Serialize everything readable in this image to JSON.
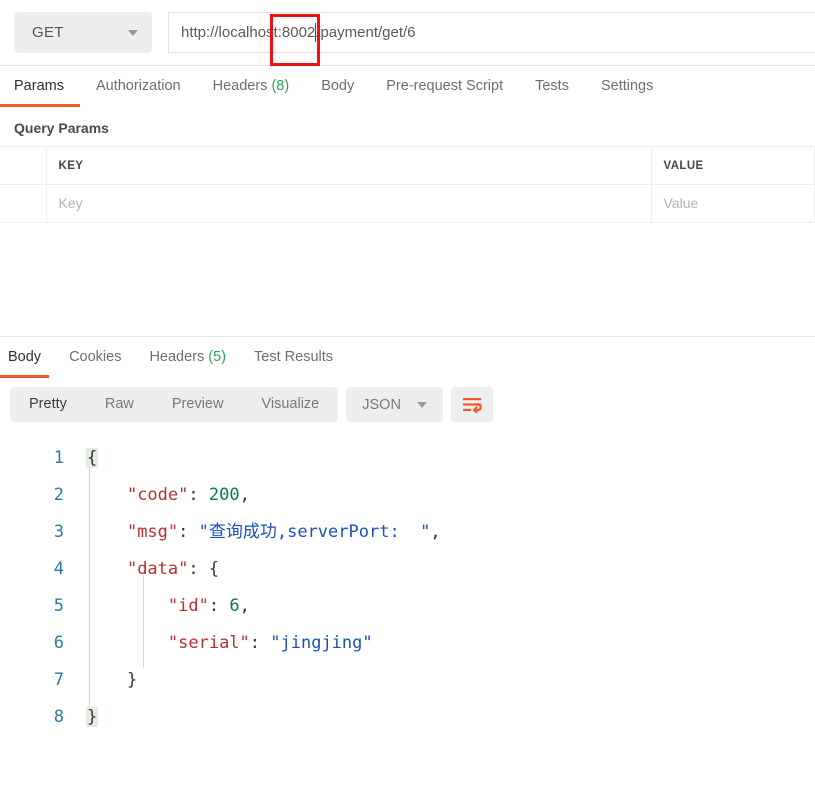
{
  "request": {
    "method": "GET",
    "url_prefix": "http://localhost",
    "url_port": ":8002",
    "url_suffix": "/payment/get/6",
    "url_full": "http://localhost:8002/payment/get/6",
    "annotation_color": "#ee1111",
    "tabs": [
      {
        "label": "Params",
        "active": true
      },
      {
        "label": "Authorization",
        "active": false
      },
      {
        "label": "Headers",
        "count": "(8)",
        "active": false
      },
      {
        "label": "Body",
        "active": false
      },
      {
        "label": "Pre-request Script",
        "active": false
      },
      {
        "label": "Tests",
        "active": false
      },
      {
        "label": "Settings",
        "active": false
      }
    ],
    "query_params_label": "Query Params",
    "table": {
      "headers": [
        "KEY",
        "VALUE"
      ],
      "placeholder_row": {
        "key": "Key",
        "value": "Value"
      }
    }
  },
  "response": {
    "tabs": [
      {
        "label": "Body",
        "active": true
      },
      {
        "label": "Cookies",
        "active": false
      },
      {
        "label": "Headers",
        "count": "(5)",
        "active": false
      },
      {
        "label": "Test Results",
        "active": false
      }
    ],
    "format_buttons": [
      {
        "label": "Pretty",
        "active": true
      },
      {
        "label": "Raw",
        "active": false
      },
      {
        "label": "Preview",
        "active": false
      },
      {
        "label": "Visualize",
        "active": false
      }
    ],
    "language": "JSON",
    "wrap_icon": "word-wrap-icon",
    "accent_color": "#ef5b25",
    "body_json": {
      "code": 200,
      "msg": "查询成功,serverPort:  ",
      "data": {
        "id": 6,
        "serial": "jingjing"
      }
    },
    "code_lines": [
      {
        "num": "1",
        "text": "{"
      },
      {
        "num": "2",
        "text": "    \"code\": 200,"
      },
      {
        "num": "3",
        "text": "    \"msg\": \"查询成功,serverPort:  \","
      },
      {
        "num": "4",
        "text": "    \"data\": {"
      },
      {
        "num": "5",
        "text": "        \"id\": 6,"
      },
      {
        "num": "6",
        "text": "        \"serial\": \"jingjing\""
      },
      {
        "num": "7",
        "text": "    }"
      },
      {
        "num": "8",
        "text": "}"
      }
    ],
    "line_numbers": [
      "1",
      "2",
      "3",
      "4",
      "5",
      "6",
      "7",
      "8"
    ]
  }
}
